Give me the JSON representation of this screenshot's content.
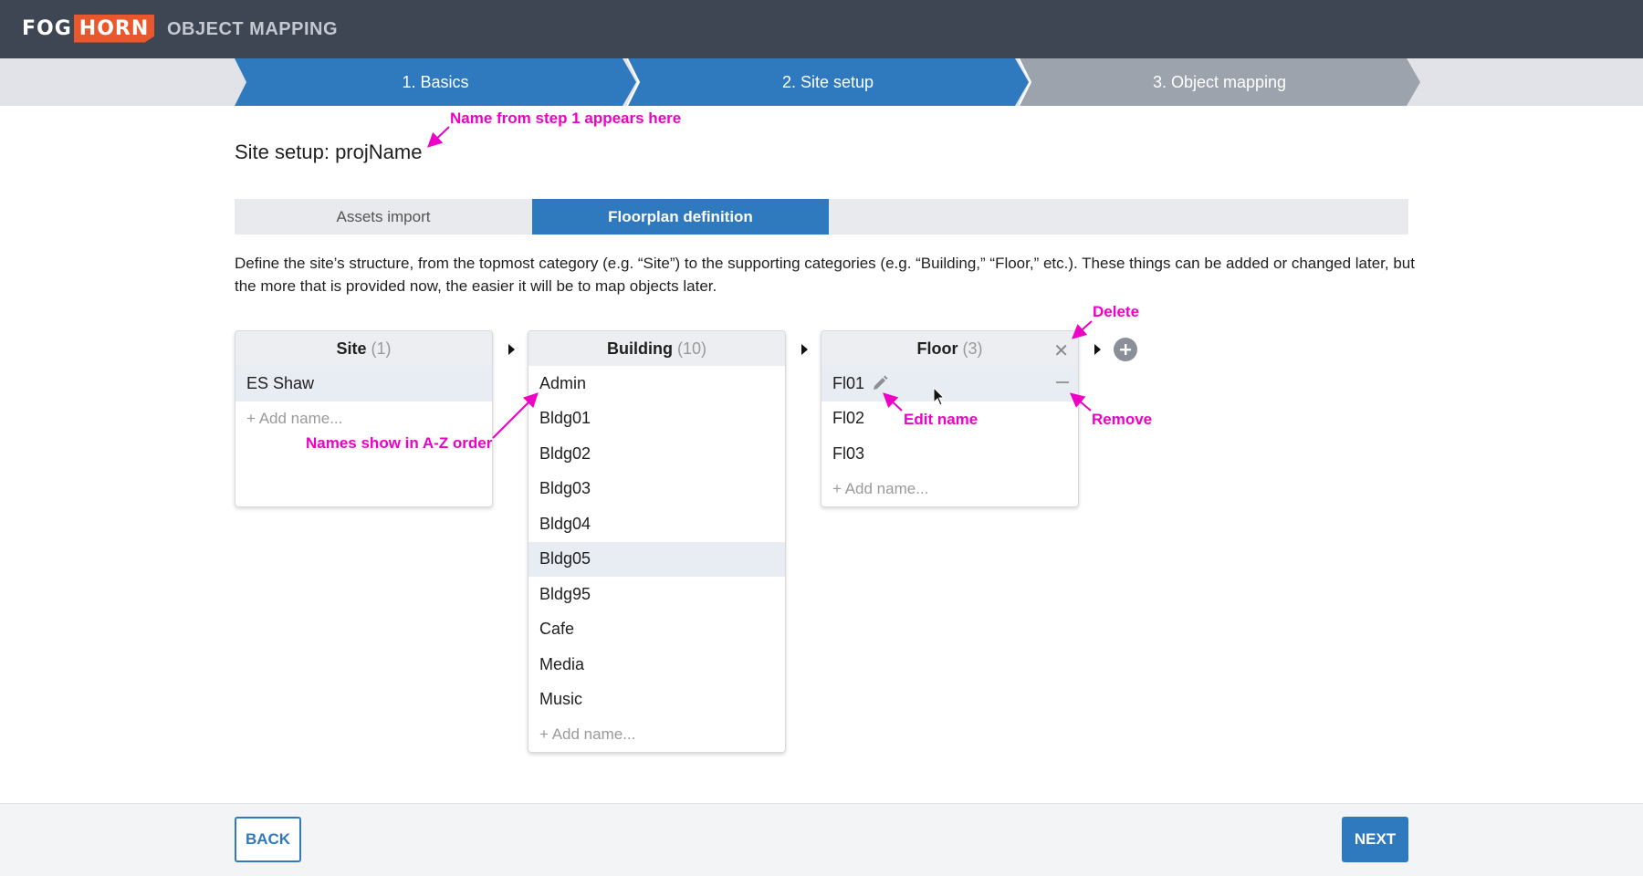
{
  "header": {
    "logo_fog": "FOG",
    "logo_horn": "HORN",
    "app_title": "OBJECT MAPPING"
  },
  "stepper": {
    "steps": [
      "1. Basics",
      "2. Site setup",
      "3. Object mapping"
    ],
    "active_count": 2
  },
  "page_title": "Site setup: projName",
  "tabs": [
    {
      "label": "Assets import",
      "active": false
    },
    {
      "label": "Floorplan definition",
      "active": true
    }
  ],
  "description": "Define the site’s structure, from the topmost category (e.g. “Site”) to the supporting categories (e.g. “Building,” “Floor,” etc.). These things can be added or changed later, but the more that is provided now, the easier it will be to map objects later.",
  "panels": {
    "site": {
      "title": "Site",
      "count": "(1)",
      "items": [
        "ES Shaw"
      ],
      "add": "+ Add name..."
    },
    "building": {
      "title": "Building",
      "count": "(10)",
      "items": [
        "Admin",
        "Bldg01",
        "Bldg02",
        "Bldg03",
        "Bldg04",
        "Bldg05",
        "Bldg95",
        "Cafe",
        "Media",
        "Music"
      ],
      "add": "+ Add name..."
    },
    "floor": {
      "title": "Floor",
      "count": "(3)",
      "items": [
        "Fl01",
        "Fl02",
        "Fl03"
      ],
      "add": "+ Add name..."
    }
  },
  "annotations": {
    "name_from_step": "Name from step 1 appears here",
    "az_order": "Names show in A-Z order",
    "delete": "Delete",
    "edit_name": "Edit name",
    "remove": "Remove"
  },
  "footer": {
    "back": "BACK",
    "next": "NEXT"
  },
  "colors": {
    "topbar": "#3e4654",
    "accent": "#2f7abf",
    "brand_orange": "#e8582c",
    "annotation": "#ee00c7"
  },
  "icons": [
    "close-icon",
    "minus-icon",
    "pencil-icon",
    "plus-circle-icon",
    "chevron-right-icon",
    "cursor-icon"
  ]
}
